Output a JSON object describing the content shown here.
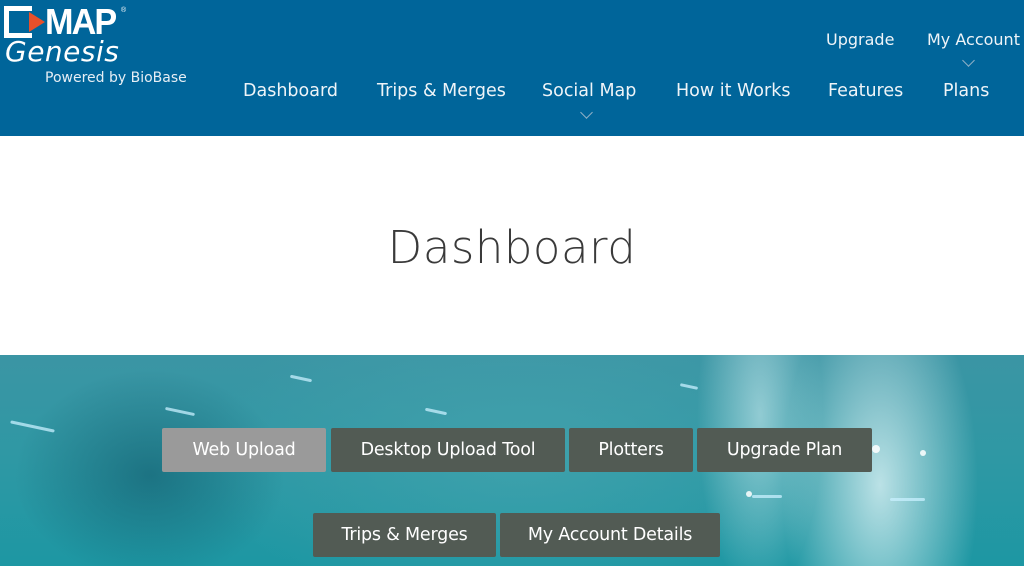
{
  "brand": {
    "logo_top": "MAP",
    "logo_registered": "®",
    "logo_sub": "Genesis",
    "tagline": "Powered by BioBase",
    "accent_color": "#e8502a",
    "header_color": "#00659a"
  },
  "top_links": [
    {
      "label": "Upgrade",
      "has_dropdown": false
    },
    {
      "label": "My Account",
      "has_dropdown": true
    }
  ],
  "nav": [
    {
      "label": "Dashboard",
      "has_dropdown": false
    },
    {
      "label": "Trips & Merges",
      "has_dropdown": false
    },
    {
      "label": "Social Map",
      "has_dropdown": true
    },
    {
      "label": "How it Works",
      "has_dropdown": false
    },
    {
      "label": "Features",
      "has_dropdown": false
    },
    {
      "label": "Plans",
      "has_dropdown": false
    }
  ],
  "page": {
    "title": "Dashboard"
  },
  "dashboard_buttons": {
    "row1": [
      {
        "label": "Web Upload",
        "active": true
      },
      {
        "label": "Desktop Upload Tool",
        "active": false
      },
      {
        "label": "Plotters",
        "active": false
      },
      {
        "label": "Upgrade Plan",
        "active": false
      }
    ],
    "row2": [
      {
        "label": "Trips & Merges",
        "active": false
      },
      {
        "label": "My Account Details",
        "active": false
      }
    ]
  }
}
